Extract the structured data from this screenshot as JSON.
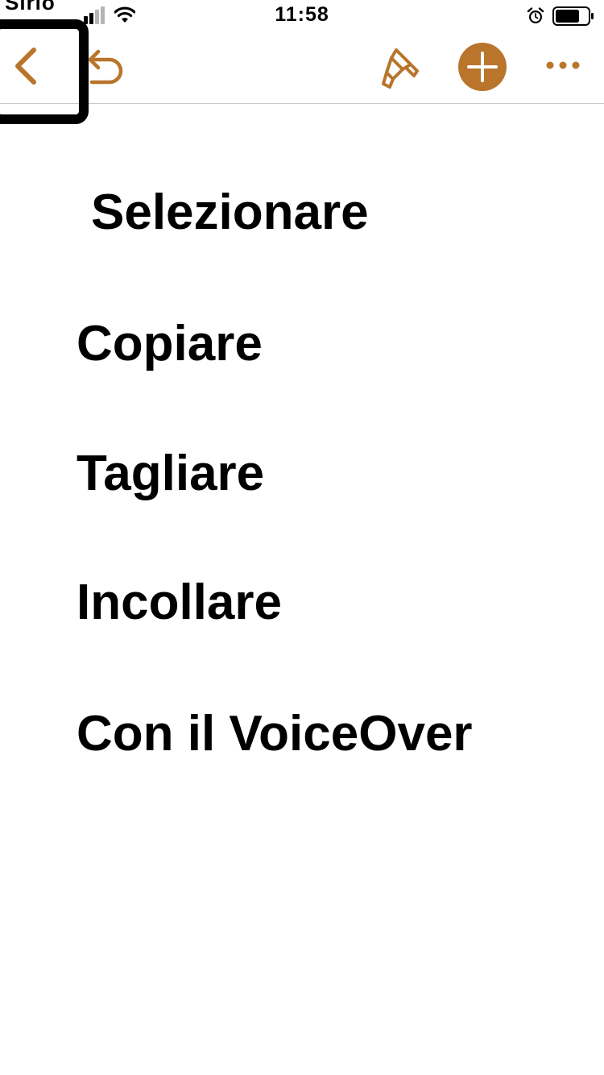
{
  "status_bar": {
    "carrier": "Sirio",
    "time": "11:58",
    "icons": [
      "signal-icon",
      "wifi-icon",
      "alarm-icon",
      "battery-icon"
    ]
  },
  "toolbar": {
    "accent_color": "#b8752b",
    "buttons": [
      "back-icon",
      "undo-icon",
      "paintbrush-icon",
      "plus-icon",
      "more-icon"
    ]
  },
  "content": {
    "items": [
      "Selezionare",
      "Copiare",
      "Tagliare",
      "Incollare",
      "Con il VoiceOver"
    ]
  }
}
